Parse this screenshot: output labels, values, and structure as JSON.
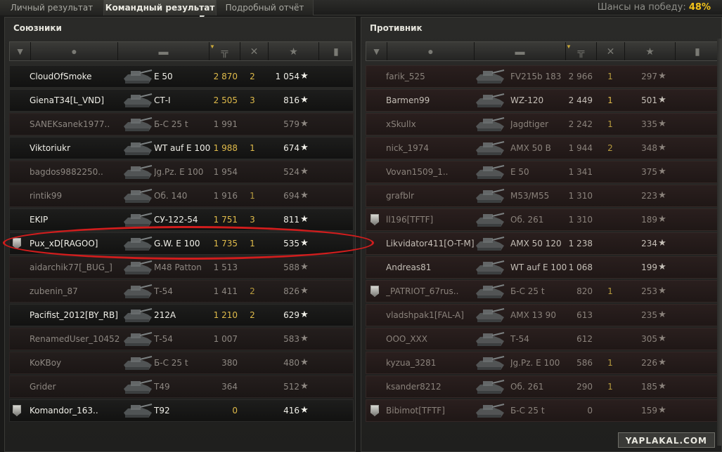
{
  "tabs": [
    {
      "label": "Личный результат",
      "active": false
    },
    {
      "label": "Командный результат",
      "active": true
    },
    {
      "label": "Подробный отчёт",
      "active": false
    }
  ],
  "win_chance": {
    "label": "Шансы на победу:",
    "value": "48%"
  },
  "allies": {
    "title": "Союзники",
    "players": [
      {
        "name": "CloudOfSmoke",
        "tank": "E 50",
        "damage": "2 870",
        "kills": "2",
        "xp": "1 054",
        "alive": true,
        "badge": false
      },
      {
        "name": "GienaT34[L_VND]",
        "tank": "СТ-I",
        "damage": "2 505",
        "kills": "3",
        "xp": "816",
        "alive": true,
        "badge": false
      },
      {
        "name": "SANEKsanek1977..",
        "tank": "Б-С 25 t",
        "damage": "1 991",
        "kills": "",
        "xp": "579",
        "alive": false,
        "badge": false
      },
      {
        "name": "Viktoriukr",
        "tank": "WT auf E 100",
        "damage": "1 988",
        "kills": "1",
        "xp": "674",
        "alive": true,
        "badge": false
      },
      {
        "name": "bagdos9882250..",
        "tank": "Jg.Pz. E 100",
        "damage": "1 954",
        "kills": "",
        "xp": "524",
        "alive": false,
        "badge": false
      },
      {
        "name": "rintik99",
        "tank": "Об. 140",
        "damage": "1 916",
        "kills": "1",
        "xp": "694",
        "alive": false,
        "badge": false
      },
      {
        "name": "EKIP",
        "tank": "СУ-122-54",
        "damage": "1 751",
        "kills": "3",
        "xp": "811",
        "alive": true,
        "badge": false
      },
      {
        "name": "Pux_xD[RAGOO]",
        "tank": "G.W. E 100",
        "damage": "1 735",
        "kills": "1",
        "xp": "535",
        "alive": true,
        "badge": true
      },
      {
        "name": "aidarchik77[_BUG_]",
        "tank": "M48 Patton",
        "damage": "1 513",
        "kills": "",
        "xp": "588",
        "alive": false,
        "badge": false
      },
      {
        "name": "zubenin_87",
        "tank": "Т-54",
        "damage": "1 411",
        "kills": "2",
        "xp": "826",
        "alive": false,
        "badge": false
      },
      {
        "name": "Pacifist_2012[BY_RB]",
        "tank": "212А",
        "damage": "1 210",
        "kills": "2",
        "xp": "629",
        "alive": true,
        "badge": false
      },
      {
        "name": "RenamedUser_10452",
        "tank": "Т-54",
        "damage": "1 007",
        "kills": "",
        "xp": "583",
        "alive": false,
        "badge": false
      },
      {
        "name": "KoKBoy",
        "tank": "Б-С 25 t",
        "damage": "380",
        "kills": "",
        "xp": "480",
        "alive": false,
        "badge": false
      },
      {
        "name": "Grider",
        "tank": "T49",
        "damage": "364",
        "kills": "",
        "xp": "512",
        "alive": false,
        "badge": false
      },
      {
        "name": "Komandor_163..",
        "tank": "T92",
        "damage": "0",
        "kills": "",
        "xp": "416",
        "alive": true,
        "badge": true
      }
    ]
  },
  "enemies": {
    "title": "Противник",
    "players": [
      {
        "name": "farik_525",
        "tank": "FV215b 183",
        "damage": "2 966",
        "kills": "1",
        "xp": "297",
        "alive": false,
        "badge": false
      },
      {
        "name": "Barmen99",
        "tank": "WZ-120",
        "damage": "2 449",
        "kills": "1",
        "xp": "501",
        "alive": true,
        "badge": false
      },
      {
        "name": "xSkullx",
        "tank": "Jagdtiger",
        "damage": "2 242",
        "kills": "1",
        "xp": "335",
        "alive": false,
        "badge": false
      },
      {
        "name": "nick_1974",
        "tank": "AMX 50 B",
        "damage": "1 944",
        "kills": "2",
        "xp": "348",
        "alive": false,
        "badge": false
      },
      {
        "name": "Vovan1509_1..",
        "tank": "E 50",
        "damage": "1 341",
        "kills": "",
        "xp": "375",
        "alive": false,
        "badge": false
      },
      {
        "name": "grafblr",
        "tank": "M53/M55",
        "damage": "1 310",
        "kills": "",
        "xp": "223",
        "alive": false,
        "badge": false
      },
      {
        "name": "ll196[TFTF]",
        "tank": "Об. 261",
        "damage": "1 310",
        "kills": "",
        "xp": "189",
        "alive": false,
        "badge": true
      },
      {
        "name": "Likvidator411[O-T-M]",
        "tank": "AMX 50 120",
        "damage": "1 238",
        "kills": "",
        "xp": "234",
        "alive": true,
        "badge": false
      },
      {
        "name": "Andreas81",
        "tank": "WT auf E 100",
        "damage": "1 068",
        "kills": "",
        "xp": "199",
        "alive": true,
        "badge": false
      },
      {
        "name": "_PATRIOT_67rus..",
        "tank": "Б-С 25 t",
        "damage": "820",
        "kills": "1",
        "xp": "253",
        "alive": false,
        "badge": true
      },
      {
        "name": "vladshpak1[FAL-A]",
        "tank": "AMX 13 90",
        "damage": "613",
        "kills": "",
        "xp": "235",
        "alive": false,
        "badge": false
      },
      {
        "name": "OOO_XXX",
        "tank": "Т-54",
        "damage": "612",
        "kills": "",
        "xp": "305",
        "alive": false,
        "badge": false
      },
      {
        "name": "kyzua_3281",
        "tank": "Jg.Pz. E 100",
        "damage": "586",
        "kills": "1",
        "xp": "226",
        "alive": false,
        "badge": false
      },
      {
        "name": "ksander8212",
        "tank": "Об. 261",
        "damage": "290",
        "kills": "1",
        "xp": "185",
        "alive": false,
        "badge": false
      },
      {
        "name": "Bibimot[TFTF]",
        "tank": "Б-С 25 t",
        "damage": "0",
        "kills": "",
        "xp": "159",
        "alive": false,
        "badge": true
      }
    ]
  },
  "watermark": "YAPLAKAL.COM",
  "icons": {
    "badge": "badge-icon",
    "player": "player-icon",
    "tank": "tank-icon",
    "damage": "damage-icon",
    "kills": "kills-icon",
    "xp": "star-icon",
    "medal": "medal-icon",
    "star_glyph": "★"
  },
  "colors": {
    "accent": "#f2c21a",
    "highlight": "#d11d1d"
  }
}
